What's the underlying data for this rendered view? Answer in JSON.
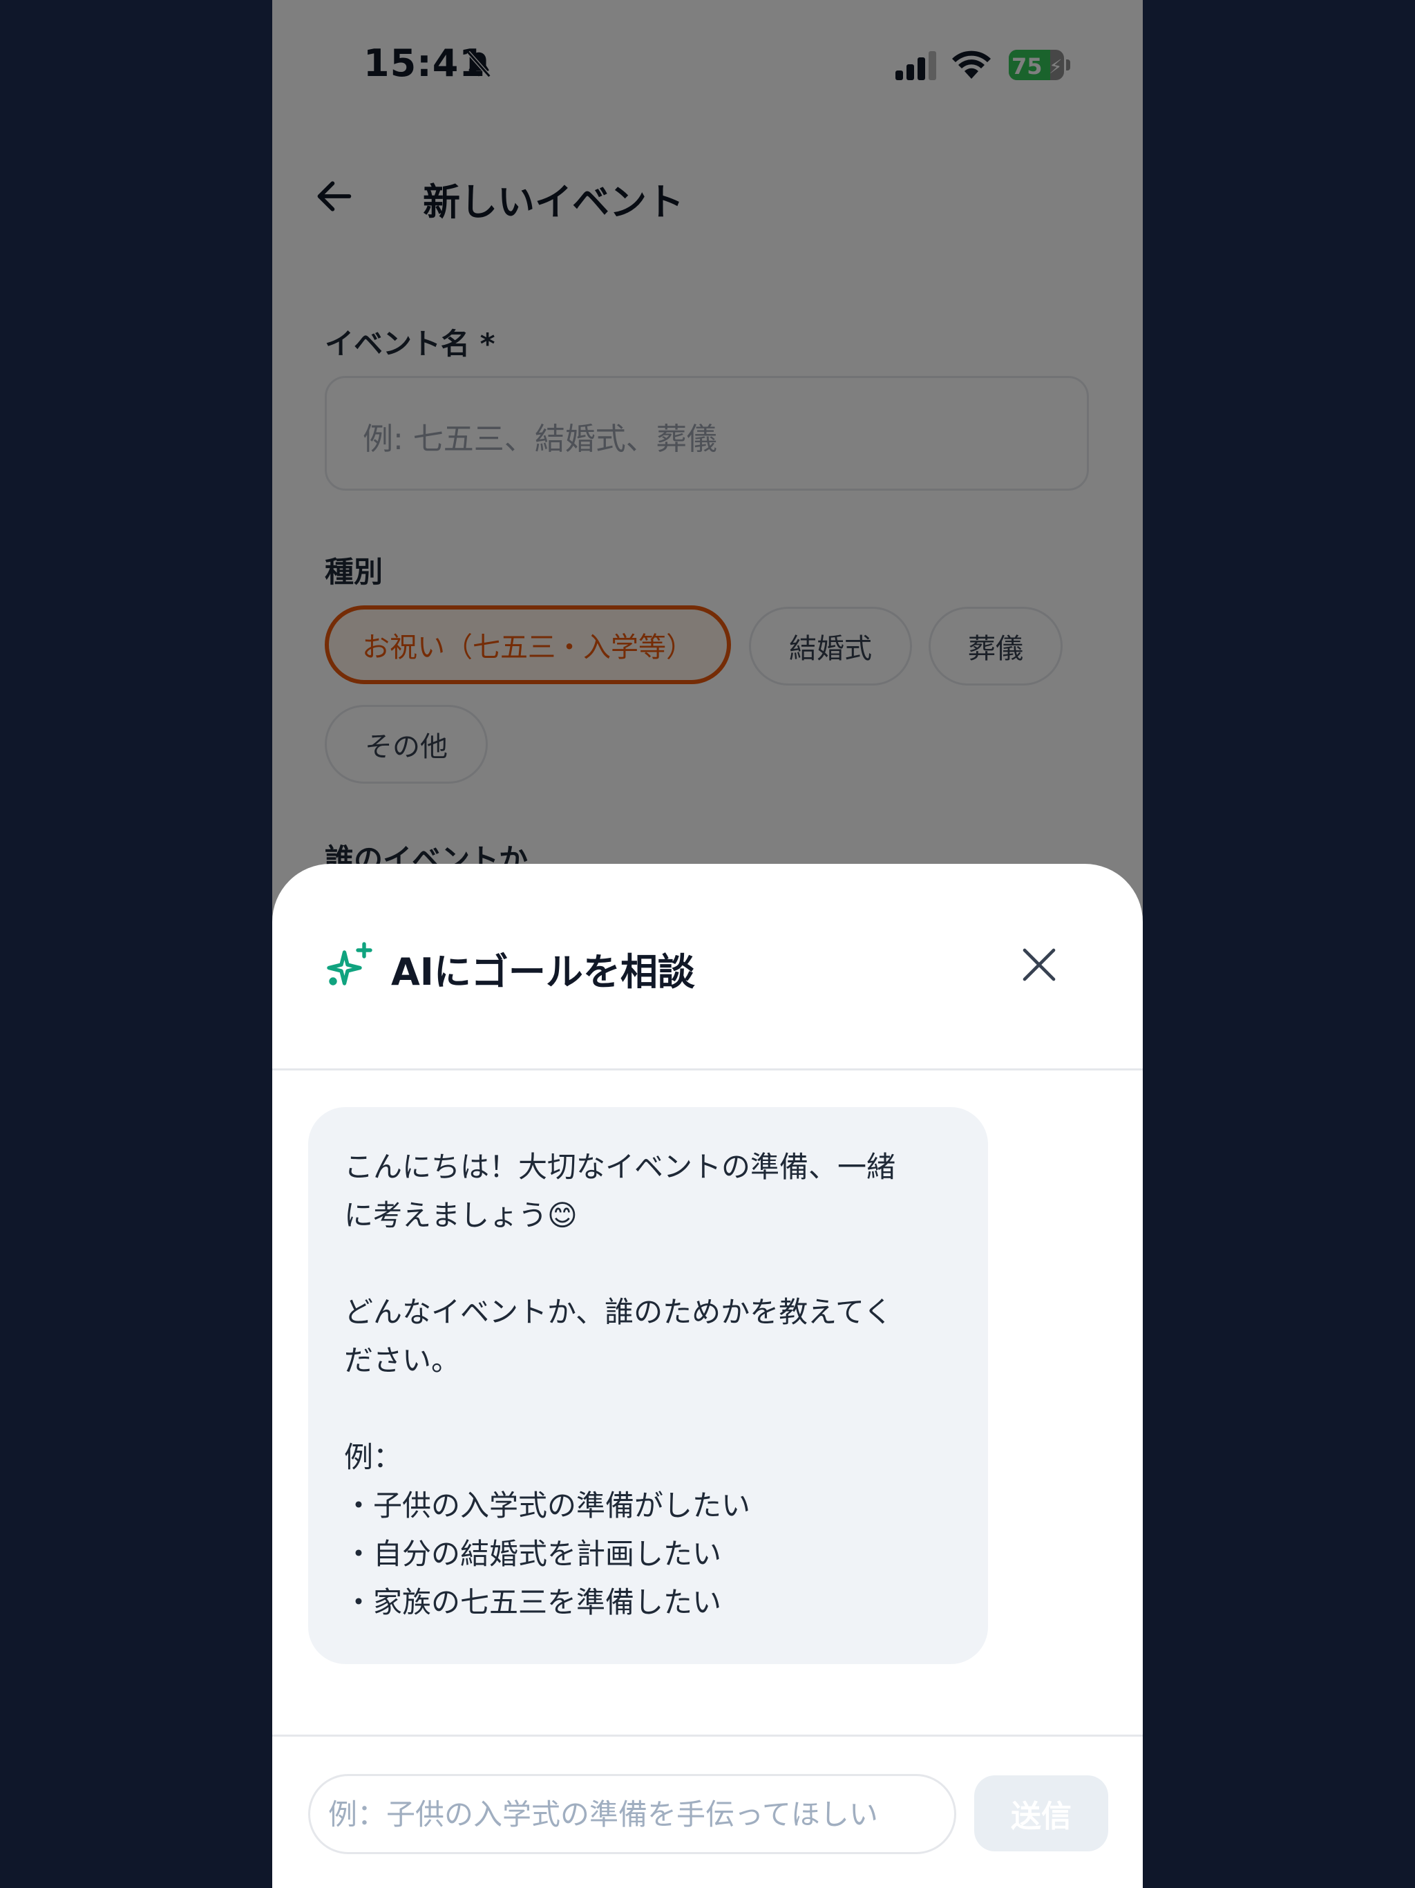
{
  "status_bar": {
    "time": "15:41",
    "battery_level": "75",
    "icons": [
      "bell-slash-icon",
      "cellular-signal-icon",
      "wifi-icon",
      "battery-charging-icon"
    ]
  },
  "app_bar": {
    "title": "新しいイベント",
    "back_icon": "arrow-left-icon"
  },
  "form": {
    "event_name_label": "イベント名 *",
    "event_name_placeholder": "例: 七五三、結婚式、葬儀",
    "type_label": "種別",
    "type_options": [
      {
        "label": "お祝い（七五三・入学等）",
        "selected": true
      },
      {
        "label": "結婚式",
        "selected": false
      },
      {
        "label": "葬儀",
        "selected": false
      },
      {
        "label": "その他",
        "selected": false
      }
    ],
    "whose_event_label": "誰のイベントか"
  },
  "ai_sheet": {
    "title": "AIにゴールを相談",
    "title_icon": "sparkles-icon",
    "close_icon": "close-icon",
    "message": {
      "line1": "こんにちは！大切なイベントの準備、一緒",
      "line2": "に考えましょう😊",
      "line3": "どんなイベントか、誰のためかを教えてく",
      "line4": "ださい。",
      "line5": "例：",
      "line6": "・子供の入学式の準備がしたい",
      "line7": "・自分の結婚式を計画したい",
      "line8": "・家族の七五三を準備したい"
    },
    "input_placeholder": "例：子供の入学式の準備を手伝ってほしい",
    "send_label": "送信"
  },
  "colors": {
    "accent": "#ea580c",
    "sparkle": "#10a37f",
    "background_outer": "#0f172a",
    "bubble": "#f0f3f7"
  }
}
